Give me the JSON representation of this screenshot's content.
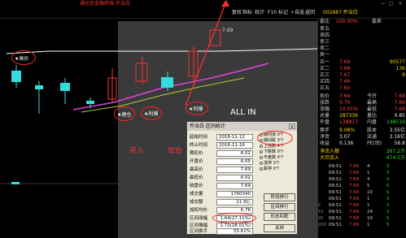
{
  "window": {
    "title": "通达信金融终端 乔治白",
    "controls": [
      "—",
      "□",
      "×"
    ]
  },
  "menu": {
    "items": [
      "复权",
      "指标",
      "统计",
      "F10",
      "标记",
      "+自选",
      "返回"
    ]
  },
  "quote": {
    "code_name": "002687 乔治白",
    "weibi_label": "委比",
    "weibi_value": "100.00%",
    "weicha_label": "委差",
    "weicha_value": "",
    "sell_levels": [
      "卖五",
      "卖四",
      "卖三",
      "卖二",
      "卖一"
    ],
    "buy_levels": [
      {
        "label": "买一",
        "price": "7.69",
        "vol": "90577"
      },
      {
        "label": "买二",
        "price": "7.68",
        "vol": "136"
      },
      {
        "label": "买三",
        "price": "7.67",
        "vol": "9"
      },
      {
        "label": "买四",
        "price": "7.66",
        "vol": ""
      },
      {
        "label": "买五",
        "price": "7.65",
        "vol": ""
      }
    ],
    "stats": [
      {
        "l1": "现价",
        "v1": "7.69",
        "l2": "今开",
        "v2": "7.69"
      },
      {
        "l1": "涨跌",
        "v1": "0.70",
        "l2": "最高",
        "v2": "7.69"
      },
      {
        "l1": "涨幅",
        "v1": "10.01%",
        "l2": "最低",
        "v2": "7.69"
      },
      {
        "l1": "总量",
        "v1": "287336",
        "l2": "量比",
        "v2": "0.85"
      },
      {
        "l1": "外盘",
        "v1": "138817",
        "l2": "内盘",
        "v2": "148519"
      },
      {
        "l1": "换手",
        "v1": "9.08%",
        "l2": "股本",
        "v2": "3.55亿"
      },
      {
        "l1": "净资",
        "v1": "3.07",
        "l2": "流通",
        "v2": "3.16亿"
      },
      {
        "l1": "收益",
        "v1": "0.136",
        "l2": "PE(动)",
        "v2": "56.8"
      }
    ],
    "fund_flow": [
      {
        "label": "净流入额",
        "value": "267.2万"
      },
      {
        "label": "大宗流入",
        "value": "474.5万"
      }
    ]
  },
  "ticks": [
    {
      "time": "09:51",
      "price": "7.69",
      "vol": "4",
      "flag": "S"
    },
    {
      "time": "09:51",
      "price": "7.69",
      "vol": "1",
      "flag": "S"
    },
    {
      "time": "09:51",
      "price": "7.69",
      "vol": "4",
      "flag": "S"
    },
    {
      "time": "09:51",
      "price": "7.69",
      "vol": "5",
      "flag": "S"
    },
    {
      "time": "09:51",
      "price": "7.69",
      "vol": "10",
      "flag": "S"
    },
    {
      "time": "09:51",
      "price": "7.69",
      "vol": "1",
      "flag": "S"
    },
    {
      "time": "09:51",
      "price": "7.69",
      "vol": "1",
      "flag": "S"
    },
    {
      "time": "09:51",
      "price": "7.69",
      "vol": "24",
      "flag": "S"
    },
    {
      "time": "09:51",
      "price": "7.69",
      "vol": "10",
      "flag": "S"
    },
    {
      "time": "09:51",
      "price": "7.69",
      "vol": "1",
      "flag": "S"
    }
  ],
  "tick_side_labels": [
    "5",
    "10",
    "20",
    "20D"
  ],
  "chart": {
    "price_mark": "7.69",
    "annotations": {
      "recent_high": "★高价",
      "enter_pos": "★建仓",
      "lock1": "★利爆",
      "lock2": "★利爆",
      "buy": "买入",
      "add": "加仓",
      "all_in": "ALL IN"
    }
  },
  "dialog": {
    "title": "乔治白 区间统计",
    "close": "×",
    "rows": [
      {
        "label": "起始时间",
        "value": "2016-11-12"
      },
      {
        "label": "终止时间",
        "value": "2016-11-16"
      },
      {
        "label": "期初价",
        "value": "6.02"
      },
      {
        "label": "开盘价",
        "value": "6.05"
      },
      {
        "label": "最高价",
        "value": "7.69"
      },
      {
        "label": "最低价",
        "value": "6.02"
      },
      {
        "label": "收盘价",
        "value": "7.69"
      },
      {
        "label": "成交量",
        "value": "1760340"
      },
      {
        "label": "成交额",
        "value": "11.9亿"
      },
      {
        "label": "加权均价",
        "value": "6.76"
      },
      {
        "label": "区间涨幅",
        "value": "1.64(27.11%)"
      },
      {
        "label": "区间振幅",
        "value": "1.72(28.01%)"
      },
      {
        "label": "区间换手",
        "value": "55.61%"
      }
    ],
    "options": [
      "期间涨 0个",
      "期间跌 3个",
      "上涨数 4个",
      "下跌数 0个",
      "平盘数 0个",
      "涨停 3个",
      "跌停 0个"
    ],
    "buttons": [
      "阶段排行",
      "区间排行",
      "形态匹配",
      "关闭"
    ]
  }
}
